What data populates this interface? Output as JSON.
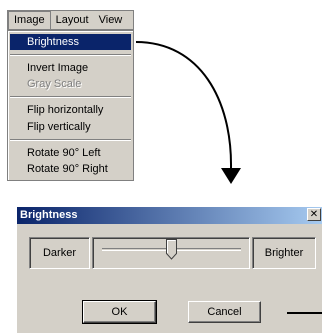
{
  "menubar": {
    "menus": [
      "Image",
      "Layout",
      "View"
    ]
  },
  "image_menu": {
    "items": [
      {
        "label": "Brightness",
        "highlighted": true,
        "enabled": true
      },
      {
        "label": "Invert Image",
        "enabled": true
      },
      {
        "label": "Gray Scale",
        "enabled": false
      },
      {
        "label": "Flip horizontally",
        "enabled": true
      },
      {
        "label": "Flip vertically",
        "enabled": true
      },
      {
        "label": "Rotate 90° Left",
        "enabled": true
      },
      {
        "label": "Rotate 90° Right",
        "enabled": true
      }
    ]
  },
  "dialog": {
    "title": "Brightness",
    "close_glyph": "✕",
    "darker_label": "Darker",
    "brighter_label": "Brighter",
    "slider_fraction": 0.5,
    "ok_label": "OK",
    "cancel_label": "Cancel"
  },
  "colors": {
    "face": "#d4d0c8",
    "highlight": "#0a246a",
    "title_gradient_end": "#a6caf0"
  }
}
